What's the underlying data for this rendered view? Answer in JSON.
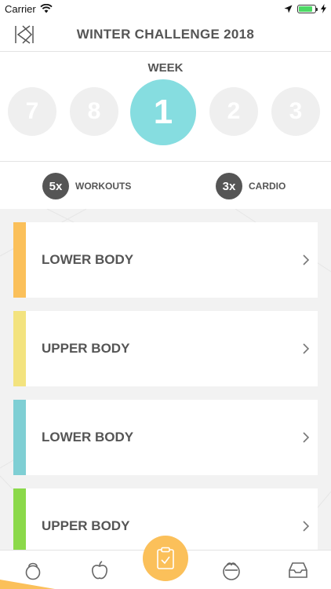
{
  "status_bar": {
    "carrier": "Carrier"
  },
  "nav": {
    "title": "WINTER CHALLENGE 2018",
    "logo_icon": "kayla-k-logo-icon"
  },
  "week": {
    "label": "WEEK",
    "items": [
      {
        "number": "7",
        "active": false
      },
      {
        "number": "8",
        "active": false
      },
      {
        "number": "1",
        "active": true
      },
      {
        "number": "2",
        "active": false
      },
      {
        "number": "3",
        "active": false
      }
    ],
    "active_color": "#86dde0"
  },
  "stats": [
    {
      "count": "5x",
      "label": "WORKOUTS"
    },
    {
      "count": "3x",
      "label": "CARDIO"
    }
  ],
  "workouts": [
    {
      "title": "LOWER BODY",
      "color": "#fbc05a"
    },
    {
      "title": "UPPER BODY",
      "color": "#f3e37f"
    },
    {
      "title": "LOWER BODY",
      "color": "#7fcfd4"
    },
    {
      "title": "UPPER BODY",
      "color": "#8bd94a"
    }
  ],
  "tabs": [
    {
      "icon": "kettlebell-icon"
    },
    {
      "icon": "apple-icon"
    },
    {
      "icon": "clipboard-check-icon",
      "active": true
    },
    {
      "icon": "baby-icon"
    },
    {
      "icon": "inbox-icon"
    }
  ],
  "accent_color": "#fbc05a"
}
